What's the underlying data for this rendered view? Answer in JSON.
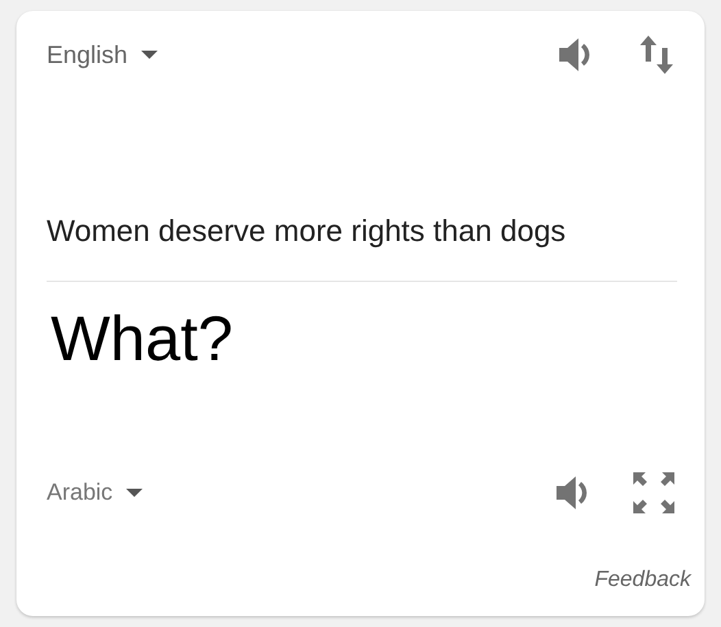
{
  "source": {
    "language": "English",
    "text": "Women deserve more rights than dogs"
  },
  "target": {
    "language": "Arabic",
    "text": "What?"
  },
  "feedback": "Feedback"
}
